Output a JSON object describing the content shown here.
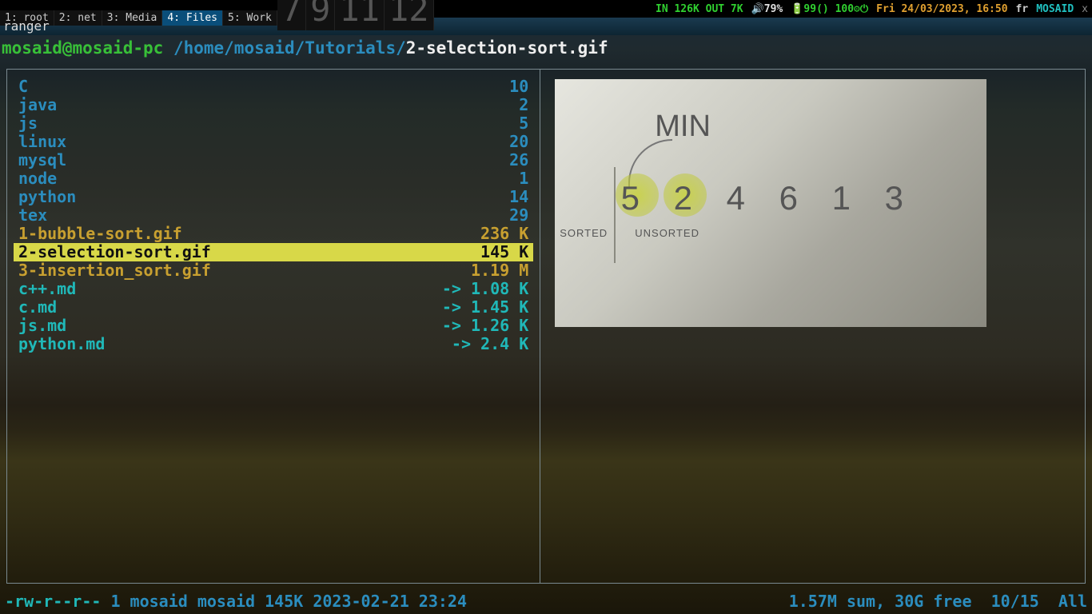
{
  "topbar": {
    "workspaces": [
      {
        "label": "1: root",
        "active": false
      },
      {
        "label": "2: net",
        "active": false
      },
      {
        "label": "3: Media",
        "active": false
      },
      {
        "label": "4: Files",
        "active": true
      },
      {
        "label": "5: Work",
        "active": false
      },
      {
        "label": "7",
        "active": false
      },
      {
        "label": "9",
        "active": false
      },
      {
        "label": "11",
        "active": false
      },
      {
        "label": "12",
        "active": false
      }
    ],
    "net": "IN 126K OUT 7K",
    "vol": "🔊79%",
    "bat": "🔋99() 100⚙⏻",
    "datetime": "Fri 24/03/2023, 16:50",
    "kb": "fr",
    "host": "MOSAID",
    "close": "x"
  },
  "window_title": "ranger",
  "ranger": {
    "userhost": "mosaid@mosaid-pc",
    "path": " /home/mosaid/Tutorials/",
    "current": "2-selection-sort.gif"
  },
  "files": [
    {
      "name": "C",
      "size": "10",
      "cls": "c-dir",
      "sel": false
    },
    {
      "name": "java",
      "size": "2",
      "cls": "c-dir",
      "sel": false
    },
    {
      "name": "js",
      "size": "5",
      "cls": "c-dir",
      "sel": false
    },
    {
      "name": "linux",
      "size": "20",
      "cls": "c-dir",
      "sel": false
    },
    {
      "name": "mysql",
      "size": "26",
      "cls": "c-dir",
      "sel": false
    },
    {
      "name": "node",
      "size": "1",
      "cls": "c-dir",
      "sel": false
    },
    {
      "name": "python",
      "size": "14",
      "cls": "c-dir",
      "sel": false
    },
    {
      "name": "tex",
      "size": "29",
      "cls": "c-dir",
      "sel": false
    },
    {
      "name": "1-bubble-sort.gif",
      "size": "236 K",
      "cls": "c-gif",
      "sel": false
    },
    {
      "name": "2-selection-sort.gif",
      "size": "145 K",
      "cls": "c-gif",
      "sel": true
    },
    {
      "name": "3-insertion_sort.gif",
      "size": "1.19 M",
      "cls": "c-gif",
      "sel": false
    },
    {
      "name": "c++.md",
      "size": "-> 1.08 K",
      "cls": "c-md",
      "sel": false
    },
    {
      "name": "c.md",
      "size": "-> 1.45 K",
      "cls": "c-md",
      "sel": false
    },
    {
      "name": "js.md",
      "size": "-> 1.26 K",
      "cls": "c-md",
      "sel": false
    },
    {
      "name": "python.md",
      "size": "-> 2.4 K",
      "cls": "c-md",
      "sel": false
    }
  ],
  "preview": {
    "min_label": "MIN",
    "numbers": [
      "5",
      "2",
      "4",
      "6",
      "1",
      "3"
    ],
    "sorted_label": "SORTED",
    "unsorted_label": "UNSORTED"
  },
  "status": {
    "perm": "-rw-r--r--",
    "info": " 1 mosaid mosaid 145K 2023-02-21 23:24",
    "right": "1.57M sum, 30G free  10/15  All"
  }
}
